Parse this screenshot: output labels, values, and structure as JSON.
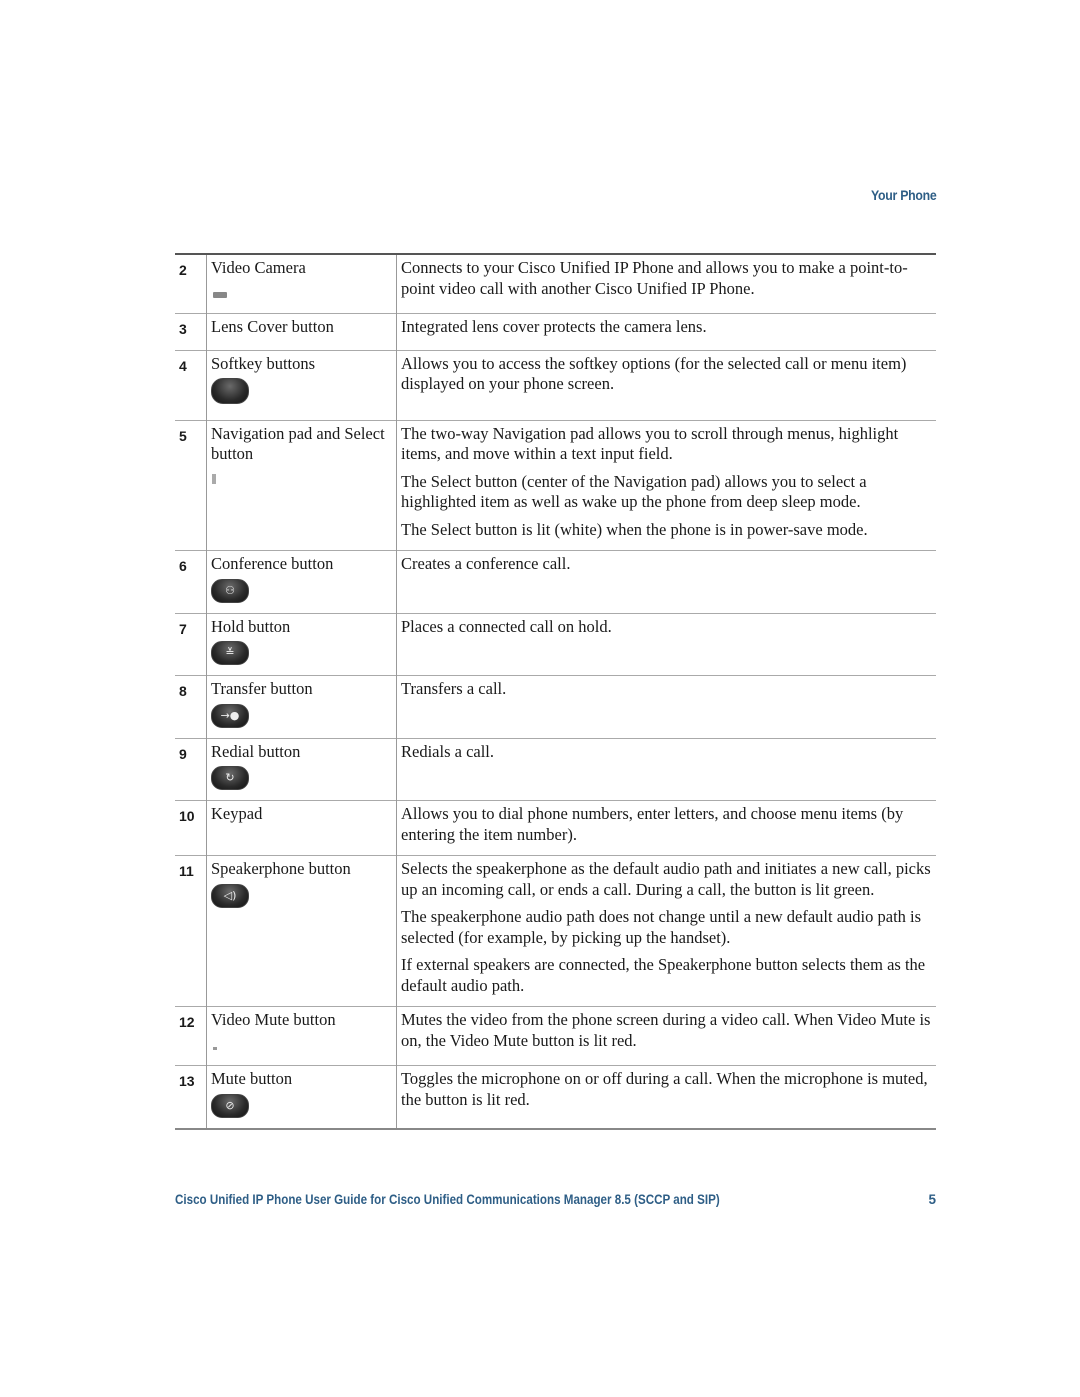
{
  "header": {
    "section": "Your Phone"
  },
  "colors": {
    "accent": "#2e5e86"
  },
  "rows": [
    {
      "num": "2",
      "name": "Video Camera",
      "icon": "video-camera-icon",
      "desc": [
        "Connects to your Cisco Unified IP Phone and allows you to make a point-to-point video call with another Cisco Unified IP Phone."
      ]
    },
    {
      "num": "3",
      "name": "Lens Cover button",
      "icon": "",
      "desc": [
        "Integrated lens cover protects the camera lens."
      ]
    },
    {
      "num": "4",
      "name": "Softkey buttons",
      "icon": "softkey-button-icon",
      "desc": [
        "Allows you to access the softkey options (for the selected call or menu item) displayed on your phone screen."
      ]
    },
    {
      "num": "5",
      "name": "Navigation pad and Select button",
      "icon": "navigation-pad-icon",
      "desc": [
        "The two-way Navigation pad allows you to scroll through menus, highlight items, and move within a text input field.",
        "The Select button (center of the Navigation pad) allows you to select a highlighted item as well as wake up the phone from deep sleep mode.",
        "The Select button is lit (white) when the phone is in power-save mode."
      ]
    },
    {
      "num": "6",
      "name": "Conference button",
      "icon": "conference-icon",
      "glyph": "⚇",
      "desc": [
        "Creates a conference call."
      ]
    },
    {
      "num": "7",
      "name": "Hold button",
      "icon": "hold-icon",
      "glyph": "≚",
      "desc": [
        "Places a connected call on hold."
      ]
    },
    {
      "num": "8",
      "name": "Transfer button",
      "icon": "transfer-icon",
      "glyph": "→●",
      "desc": [
        "Transfers a call."
      ]
    },
    {
      "num": "9",
      "name": "Redial button",
      "icon": "redial-icon",
      "glyph": "↻",
      "desc": [
        "Redials a call."
      ]
    },
    {
      "num": "10",
      "name": "Keypad",
      "icon": "",
      "desc": [
        "Allows you to dial phone numbers, enter letters, and choose menu items (by entering the item number)."
      ]
    },
    {
      "num": "11",
      "name": "Speakerphone button",
      "icon": "speaker-icon",
      "glyph": "◁)",
      "desc": [
        "Selects the speakerphone as the default audio path and initiates a new call, picks up an incoming call, or ends a call. During a call, the button is lit green.",
        "The speakerphone audio path does not change until a new default audio path is selected (for example, by picking up the handset).",
        "If external speakers are connected, the Speakerphone button selects them as the default audio path."
      ]
    },
    {
      "num": "12",
      "name": "Video Mute button",
      "icon": "video-mute-icon",
      "desc": [
        "Mutes the video from the phone screen during a video call. When Video Mute is on, the Video Mute button is lit red."
      ]
    },
    {
      "num": "13",
      "name": "Mute button",
      "icon": "mute-icon",
      "glyph": "⊘",
      "desc": [
        "Toggles the microphone on or off during a call. When the microphone is muted, the button is lit red."
      ]
    }
  ],
  "footer": {
    "title": "Cisco Unified IP Phone User Guide for Cisco Unified Communications Manager 8.5 (SCCP and SIP)",
    "page": "5"
  }
}
